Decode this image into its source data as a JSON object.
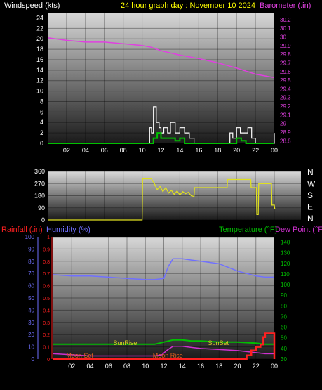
{
  "colors": {
    "background": "#000000",
    "label_white": "#ffffff",
    "title_yellow": "#ffff00",
    "barometer": "#e040e0",
    "gust": "#ffffff",
    "wind_avg": "#00c000",
    "direction": "#e0e020",
    "rainfall": "#ff2020",
    "humidity": "#7070ff",
    "temperature": "#00c000",
    "dewpoint": "#d030d0",
    "sun_label": "#d8d020",
    "moon_label": "#e06020"
  },
  "chart_data": [
    {
      "type": "line",
      "title": "24 hour graph day : November 10 2024",
      "left_axis_label": "Windspeed (kts)",
      "right_axis_label": "Barometer (.in)",
      "x_tick_labels": [
        "02",
        "04",
        "06",
        "08",
        "10",
        "12",
        "14",
        "16",
        "18",
        "20",
        "22",
        "00"
      ],
      "x_tick_hours": [
        2,
        4,
        6,
        8,
        10,
        12,
        14,
        16,
        18,
        20,
        22,
        24
      ],
      "xlim": [
        0,
        24
      ],
      "left_ylim": [
        0,
        25
      ],
      "left_ticks": [
        0,
        2,
        4,
        6,
        8,
        10,
        12,
        14,
        16,
        18,
        20,
        22,
        24
      ],
      "right_ylim": [
        28.77,
        30.28
      ],
      "right_ticks": [
        "28.8",
        "28.9",
        "29",
        "29.1",
        "29.2",
        "29.3",
        "29.4",
        "29.5",
        "29.6",
        "29.7",
        "29.8",
        "29.9",
        "30",
        "30.1",
        "30.2"
      ],
      "grid": true,
      "series": [
        {
          "name": "Barometer",
          "axis": "right",
          "x": [
            0,
            2,
            4,
            6,
            8,
            10,
            11,
            12,
            14,
            16,
            18,
            20,
            22,
            24
          ],
          "y": [
            29.99,
            29.96,
            29.94,
            29.94,
            29.92,
            29.9,
            29.88,
            29.84,
            29.79,
            29.75,
            29.7,
            29.64,
            29.57,
            29.53
          ]
        },
        {
          "name": "Wind gust",
          "axis": "left",
          "x": [
            0,
            10.8,
            11.0,
            11.2,
            11.5,
            11.8,
            12.0,
            12.3,
            12.7,
            13.0,
            13.5,
            14.0,
            14.5,
            15.0,
            15.5,
            19.0,
            19.3,
            19.6,
            20.0,
            20.4,
            20.8,
            21.2,
            21.6,
            22.0,
            23.8,
            24.0
          ],
          "y": [
            0,
            3,
            2,
            7,
            4,
            3,
            2,
            3,
            2,
            4,
            2,
            3,
            2,
            1,
            0,
            0,
            2,
            1,
            3,
            2,
            2,
            3,
            1,
            0,
            0,
            2
          ]
        },
        {
          "name": "Wind average",
          "axis": "left",
          "x": [
            0,
            10.8,
            11.2,
            11.6,
            12.0,
            12.5,
            13.0,
            13.5,
            14.0,
            14.5,
            19.5,
            20.0,
            20.5,
            21.0,
            24.0
          ],
          "y": [
            0,
            0,
            1,
            2,
            1,
            1,
            1,
            0.5,
            1,
            0,
            0,
            1,
            0.5,
            0,
            0
          ]
        }
      ]
    },
    {
      "type": "line",
      "left_ylim": [
        0,
        360
      ],
      "left_ticks": [
        0,
        90,
        180,
        270,
        360
      ],
      "right_letters": [
        "N",
        "W",
        "S",
        "E",
        "N"
      ],
      "xlim": [
        0,
        24
      ],
      "grid": true,
      "series": [
        {
          "name": "Wind direction",
          "x": [
            0,
            10,
            10.05,
            11.0,
            11.3,
            11.6,
            11.9,
            12.2,
            12.5,
            12.8,
            13.1,
            13.4,
            13.7,
            14.0,
            14.3,
            14.6,
            14.9,
            15.2,
            15.5,
            15.55,
            19.0,
            19.05,
            21.5,
            21.55,
            22.1,
            22.15,
            22.3,
            22.35,
            23.7,
            23.75,
            24.0,
            24.05
          ],
          "y": [
            0,
            0,
            305,
            305,
            270,
            225,
            250,
            210,
            240,
            200,
            220,
            190,
            215,
            185,
            210,
            195,
            205,
            180,
            175,
            240,
            240,
            300,
            300,
            240,
            240,
            40,
            40,
            270,
            270,
            110,
            110,
            80
          ]
        }
      ]
    },
    {
      "type": "line",
      "left_axis_labels": [
        "Rainfall (.in)",
        "Humidity (%)"
      ],
      "right_axis_labels": [
        "Temperature (°F)",
        "Dew Point (°F)"
      ],
      "x_tick_labels": [
        "02",
        "04",
        "06",
        "08",
        "10",
        "12",
        "14",
        "16",
        "18",
        "20",
        "22",
        "00"
      ],
      "x_tick_hours": [
        2,
        4,
        6,
        8,
        10,
        12,
        14,
        16,
        18,
        20,
        22,
        24
      ],
      "xlim": [
        0,
        24
      ],
      "humidity_ylim": [
        0,
        100
      ],
      "humidity_ticks": [
        0,
        10,
        20,
        30,
        40,
        50,
        60,
        70,
        80,
        90,
        100
      ],
      "rain_ylim": [
        0,
        1.0
      ],
      "rain_ticks": [
        "0",
        "0.1",
        "0.2",
        "0.3",
        "0.4",
        "0.5",
        "0.6",
        "0.7",
        "0.8",
        "0.9",
        "1"
      ],
      "temp_ylim": [
        30,
        145
      ],
      "temp_ticks": [
        30,
        40,
        50,
        60,
        70,
        80,
        90,
        100,
        110,
        120,
        130,
        140
      ],
      "grid": true,
      "series": [
        {
          "name": "Humidity",
          "axis": "humidity",
          "x": [
            0,
            2,
            4,
            6,
            8,
            10,
            11,
            12,
            12.5,
            13,
            14,
            15,
            16,
            18,
            20,
            22,
            23,
            24
          ],
          "y": [
            69,
            68,
            68,
            67,
            66,
            65,
            65,
            66,
            76,
            82,
            82,
            81,
            80,
            78,
            72,
            68,
            67,
            67
          ]
        },
        {
          "name": "Temperature",
          "axis": "temperature",
          "x": [
            0,
            2,
            4,
            6,
            8,
            10,
            11,
            12,
            13,
            14,
            15,
            16,
            18,
            20,
            22,
            23,
            24
          ],
          "y": [
            44,
            44,
            44,
            44,
            44,
            44,
            44,
            46,
            48,
            48,
            47,
            47,
            46,
            46,
            45,
            44,
            44
          ]
        },
        {
          "name": "Dew Point",
          "axis": "temperature",
          "x": [
            0,
            2,
            4,
            6,
            8,
            10,
            11,
            11.8,
            12.3,
            13,
            14,
            15,
            16,
            18,
            20,
            22,
            23,
            24
          ],
          "y": [
            35,
            34,
            33,
            33,
            33,
            33,
            33,
            34,
            38,
            42,
            42,
            41,
            40,
            39,
            38,
            36,
            35,
            35
          ]
        },
        {
          "name": "Rainfall",
          "axis": "rain",
          "x": [
            0,
            20,
            21,
            21.5,
            22,
            22.5,
            22.8,
            23.0,
            23.8,
            24.0
          ],
          "y": [
            0,
            0,
            0.03,
            0.07,
            0.1,
            0.12,
            0.18,
            0.21,
            0.21,
            0.0
          ]
        }
      ],
      "annotations": [
        {
          "text": "SunSet",
          "hour": 16.8,
          "row": "upper",
          "color": "sun"
        },
        {
          "text": "SunRise",
          "hour": 6.5,
          "row": "upper",
          "color": "sun"
        },
        {
          "text": "Moon Rise",
          "hour": 10.8,
          "row": "lower",
          "color": "moon"
        },
        {
          "text": "Moon Set",
          "hour": 1.4,
          "row": "lower",
          "color": "moon"
        }
      ]
    }
  ]
}
